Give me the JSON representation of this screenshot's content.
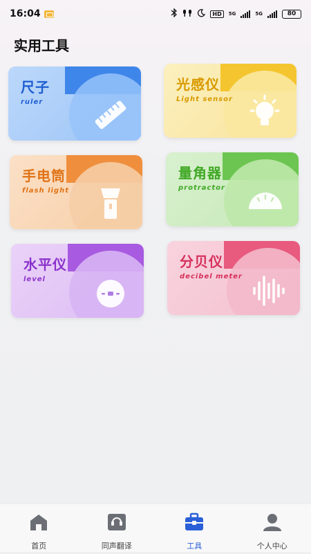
{
  "status_bar": {
    "time": "16:04",
    "network_labels": [
      "HD",
      "5G",
      "5G"
    ],
    "battery": "80"
  },
  "page": {
    "title": "实用工具"
  },
  "tools": [
    {
      "id": "ruler",
      "title": "尺子",
      "subtitle": "ruler",
      "icon": "ruler-icon",
      "color": "#3f86ea"
    },
    {
      "id": "light",
      "title": "光感仪",
      "subtitle": "Light sensor",
      "icon": "lightbulb-icon",
      "color": "#f4c52e"
    },
    {
      "id": "flash",
      "title": "手电筒",
      "subtitle": "flash light",
      "icon": "flashlight-icon",
      "color": "#ef8f3d"
    },
    {
      "id": "protractor",
      "title": "量角器",
      "subtitle": "protractor",
      "icon": "protractor-icon",
      "color": "#6cc550"
    },
    {
      "id": "level",
      "title": "水平仪",
      "subtitle": "level",
      "icon": "level-icon",
      "color": "#a85ae0"
    },
    {
      "id": "decibel",
      "title": "分贝仪",
      "subtitle": "decibel meter",
      "icon": "soundwave-icon",
      "color": "#e85a7e"
    }
  ],
  "tabbar": {
    "items": [
      {
        "label": "首页",
        "icon": "home-icon",
        "active": false
      },
      {
        "label": "同声翻译",
        "icon": "translate-icon",
        "active": false
      },
      {
        "label": "工具",
        "icon": "toolbox-icon",
        "active": true
      },
      {
        "label": "个人中心",
        "icon": "user-icon",
        "active": false
      }
    ],
    "active_color": "#2a5fd8"
  }
}
